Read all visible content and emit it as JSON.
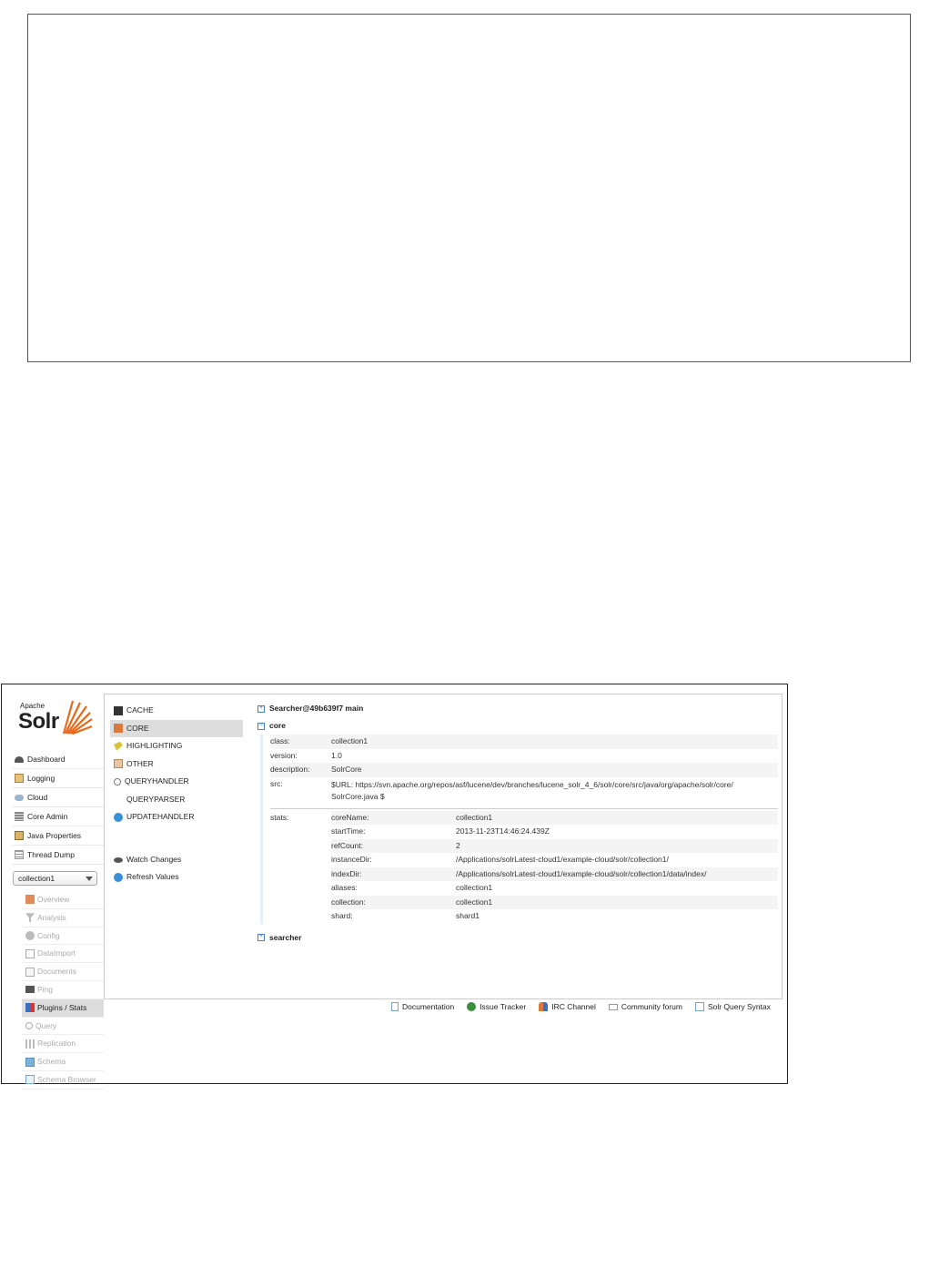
{
  "logo": {
    "apache": "Apache",
    "solr": "Solr"
  },
  "nav": [
    {
      "label": "Dashboard",
      "icon": "dashboard-icon"
    },
    {
      "label": "Logging",
      "icon": "logging-icon"
    },
    {
      "label": "Cloud",
      "icon": "cloud-icon"
    },
    {
      "label": "Core Admin",
      "icon": "core-admin-icon"
    },
    {
      "label": "Java Properties",
      "icon": "java-properties-icon"
    },
    {
      "label": "Thread Dump",
      "icon": "thread-dump-icon"
    }
  ],
  "core_selector": {
    "selected": "collection1"
  },
  "core_menu": [
    {
      "label": "Overview"
    },
    {
      "label": "Analysis"
    },
    {
      "label": "Config"
    },
    {
      "label": "DataImport"
    },
    {
      "label": "Documents"
    },
    {
      "label": "Ping"
    },
    {
      "label": "Plugins / Stats"
    },
    {
      "label": "Query"
    },
    {
      "label": "Replication"
    },
    {
      "label": "Schema"
    },
    {
      "label": "Schema Browser"
    }
  ],
  "plugin_nav": [
    {
      "label": "CACHE"
    },
    {
      "label": "CORE"
    },
    {
      "label": "HIGHLIGHTING"
    },
    {
      "label": "OTHER"
    },
    {
      "label": "QUERYHANDLER"
    },
    {
      "label": "QUERYPARSER"
    },
    {
      "label": "UPDATEHANDLER"
    }
  ],
  "actions": {
    "watch": "Watch Changes",
    "refresh": "Refresh Values"
  },
  "content": {
    "searcher_main": "Searcher@49b639f7 main",
    "core": {
      "title": "core",
      "class_k": "class:",
      "class_v": "collection1",
      "version_k": "version:",
      "version_v": "1.0",
      "description_k": "description:",
      "description_v": "SolrCore",
      "src_k": "src:",
      "src_v1": "$URL: https://svn.apache.org/repos/asf/lucene/dev/branches/lucene_solr_4_6/solr/core/src/java/org/apache/solr/core/",
      "src_v2": "SolrCore.java $",
      "stats_k": "stats:",
      "stats": [
        {
          "k": "coreName:",
          "v": "collection1"
        },
        {
          "k": "startTime:",
          "v": "2013-11-23T14:46:24.439Z"
        },
        {
          "k": "refCount:",
          "v": "2"
        },
        {
          "k": "instanceDir:",
          "v": "/Applications/solrLatest-cloud1/example-cloud/solr/collection1/"
        },
        {
          "k": "indexDir:",
          "v": "/Applications/solrLatest-cloud1/example-cloud/solr/collection1/data/index/"
        },
        {
          "k": "aliases:",
          "v": "collection1"
        },
        {
          "k": "collection:",
          "v": "collection1"
        },
        {
          "k": "shard:",
          "v": "shard1"
        }
      ]
    },
    "searcher": "searcher"
  },
  "footer": {
    "documentation": "Documentation",
    "issue_tracker": "Issue Tracker",
    "irc": "IRC Channel",
    "forum": "Community forum",
    "syntax": "Solr Query Syntax"
  }
}
